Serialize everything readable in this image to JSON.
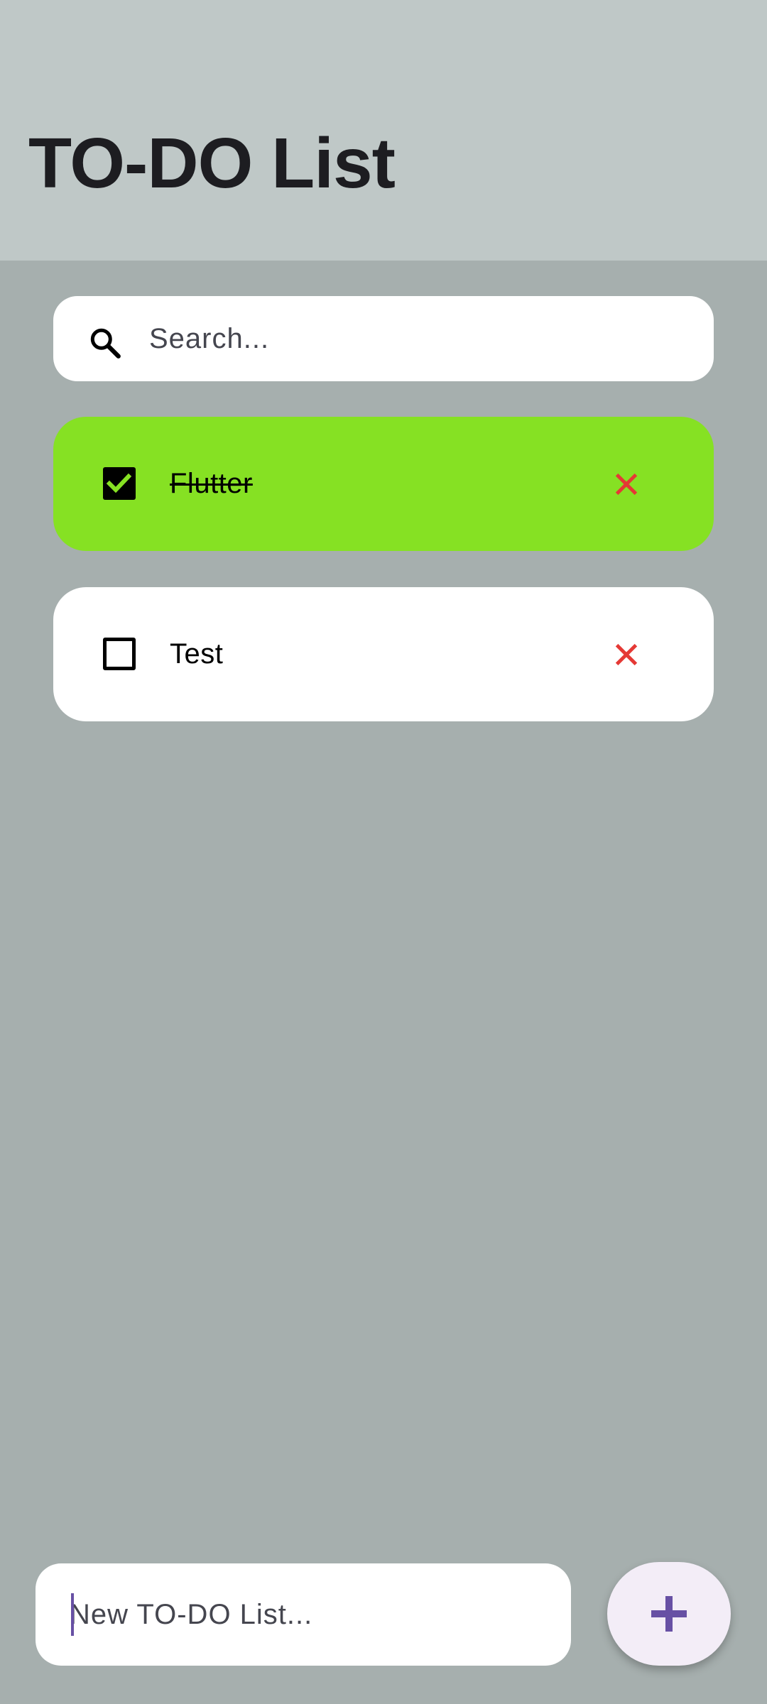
{
  "app_bar": {
    "title": "TO-DO List"
  },
  "search": {
    "placeholder": "Search...",
    "icon": "search-icon"
  },
  "todos": [
    {
      "label": "Flutter",
      "done": true,
      "color": "#86e123"
    },
    {
      "label": "Test",
      "done": false,
      "color": "#ffffff"
    }
  ],
  "new_todo": {
    "placeholder": "New TO-DO List..."
  },
  "add_button": {
    "icon": "plus-icon"
  },
  "colors": {
    "background": "#a6afae",
    "app_bar": "#bfc8c7",
    "delete_icon": "#e53935",
    "accent": "#6750a4",
    "add_button_bg": "#f3edf7"
  }
}
